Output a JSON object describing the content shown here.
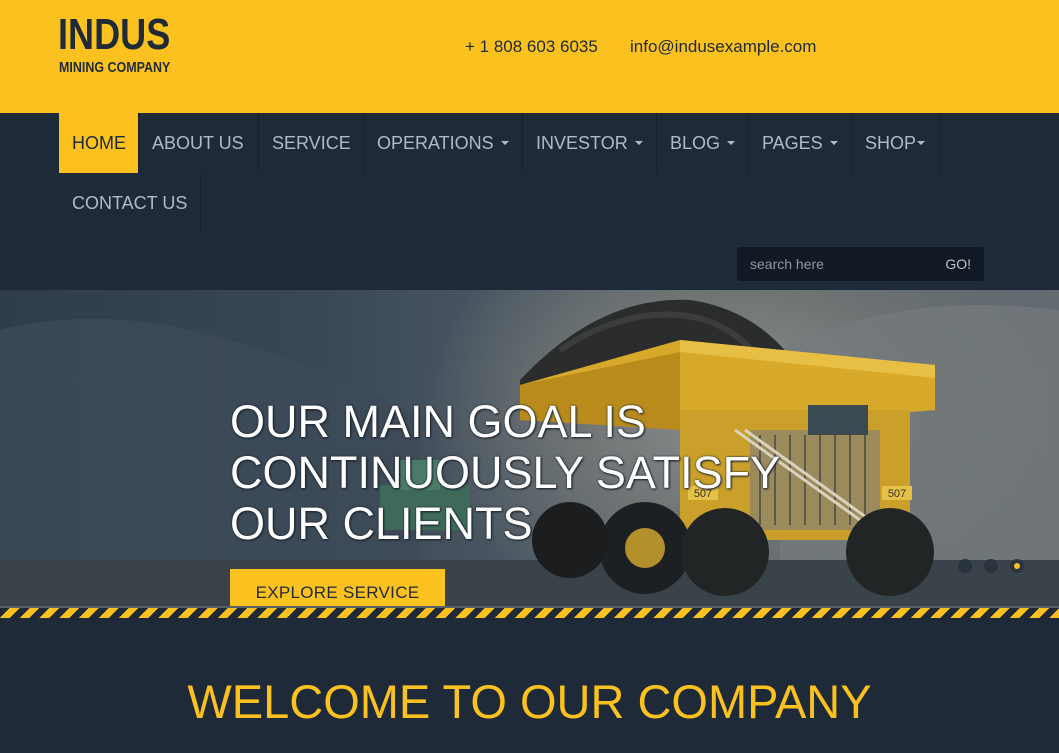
{
  "header": {
    "logo_title": "INDUS",
    "logo_subtitle": "MINING COMPANY",
    "phone": "+ 1 808 603 6035",
    "email": "info@indusexample.com"
  },
  "nav": {
    "items": [
      {
        "label": "HOME"
      },
      {
        "label": "ABOUT US"
      },
      {
        "label": "SERVICE"
      },
      {
        "label": "OPERATIONS"
      },
      {
        "label": "INVESTOR"
      },
      {
        "label": "BLOG"
      },
      {
        "label": "PAGES"
      },
      {
        "label": "SHOP"
      },
      {
        "label": "CONTACT US"
      }
    ]
  },
  "search": {
    "placeholder": "search here",
    "button": "GO!"
  },
  "hero": {
    "title": "OUR MAIN GOAL IS CONTINUOUSLY SATISFY OUR CLIENTS",
    "button": "EXPLORE SERVICE",
    "truck_number": "507"
  },
  "welcome": {
    "title": "WELCOME TO OUR COMPANY"
  },
  "colors": {
    "accent": "#fbc21f",
    "dark": "#1e2a38"
  }
}
